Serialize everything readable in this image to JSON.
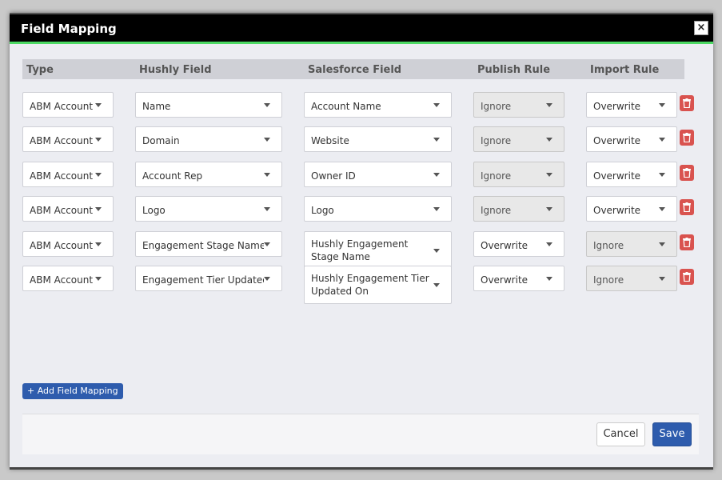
{
  "modal": {
    "title": "Field Mapping",
    "close_symbol": "×"
  },
  "columns": [
    "Type",
    "Hushly Field",
    "Salesforce Field",
    "Publish Rule",
    "Import Rule"
  ],
  "rows": [
    {
      "type": "ABM Account",
      "hushly": "Name",
      "salesforce": "Account Name",
      "publish": "Ignore",
      "import": "Overwrite",
      "publish_disabled": true,
      "import_disabled": false
    },
    {
      "type": "ABM Account",
      "hushly": "Domain",
      "salesforce": "Website",
      "publish": "Ignore",
      "import": "Overwrite",
      "publish_disabled": true,
      "import_disabled": false
    },
    {
      "type": "ABM Account",
      "hushly": "Account Rep",
      "salesforce": "Owner ID",
      "publish": "Ignore",
      "import": "Overwrite",
      "publish_disabled": true,
      "import_disabled": false
    },
    {
      "type": "ABM Account",
      "hushly": "Logo",
      "salesforce": "Logo",
      "publish": "Ignore",
      "import": "Overwrite",
      "publish_disabled": true,
      "import_disabled": false
    },
    {
      "type": "ABM Account",
      "hushly": "Engagement Stage Name",
      "salesforce": "Hushly Engagement Stage Name",
      "publish": "Overwrite",
      "import": "Ignore",
      "publish_disabled": false,
      "import_disabled": true
    },
    {
      "type": "ABM Account",
      "hushly": "Engagement Tier Updated On",
      "salesforce": "Hushly Engagement Tier Updated On",
      "publish": "Overwrite",
      "import": "Ignore",
      "publish_disabled": false,
      "import_disabled": true
    }
  ],
  "actions": {
    "add_label": "+ Add Field Mapping",
    "cancel_label": "Cancel",
    "save_label": "Save"
  },
  "colors": {
    "header_bg": "#000000",
    "accent_green": "#4cd964",
    "primary_blue": "#2e5cad",
    "danger_red": "#d9534f"
  },
  "icons": {
    "close": "close-icon",
    "delete": "trash-icon",
    "dropdown": "caret-down-icon"
  }
}
